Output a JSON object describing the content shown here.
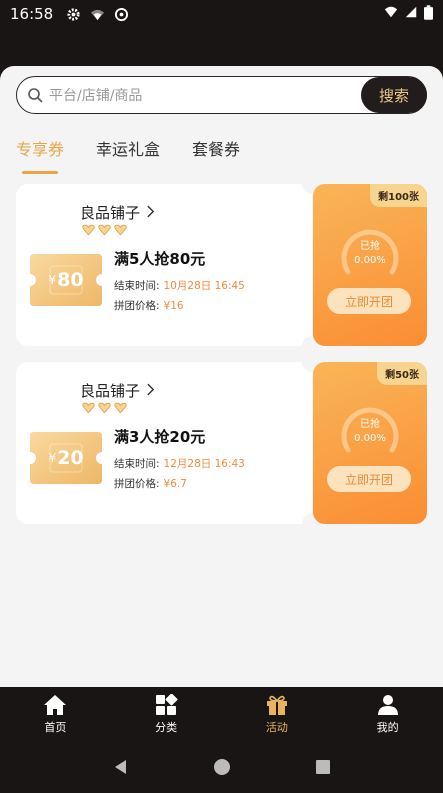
{
  "status": {
    "time": "16:58"
  },
  "search": {
    "placeholder": "平台/店铺/商品",
    "button": "搜索"
  },
  "tabs": [
    {
      "label": "专享券",
      "active": true
    },
    {
      "label": "幸运礼盒",
      "active": false
    },
    {
      "label": "套餐券",
      "active": false
    }
  ],
  "cards": [
    {
      "shop": "良品铺子",
      "currency": "¥",
      "coupon_value": "80",
      "title": "满5人抢80元",
      "end_label": "结束时间:",
      "end_value": "10月28日 16:45",
      "price_label": "拼团价格:",
      "price_value": "¥16",
      "remaining": "剩100张",
      "grabbed_label": "已抢",
      "grabbed_percent": "0.00%",
      "join": "立即开团"
    },
    {
      "shop": "良品铺子",
      "currency": "¥",
      "coupon_value": "20",
      "title": "满3人抢20元",
      "end_label": "结束时间:",
      "end_value": "12月28日 16:43",
      "price_label": "拼团价格:",
      "price_value": "¥6.7",
      "remaining": "剩50张",
      "grabbed_label": "已抢",
      "grabbed_percent": "0.00%",
      "join": "立即开团"
    }
  ],
  "nav": [
    {
      "label": "首页",
      "icon": "home-icon",
      "active": false
    },
    {
      "label": "分类",
      "icon": "category-icon",
      "active": false
    },
    {
      "label": "活动",
      "icon": "gift-icon",
      "active": true
    },
    {
      "label": "我的",
      "icon": "profile-icon",
      "active": false
    }
  ],
  "colors": {
    "accent": "#e8a64a",
    "dark": "#1a1515",
    "orange_start": "#f9b558",
    "orange_end": "#fa8d34"
  }
}
